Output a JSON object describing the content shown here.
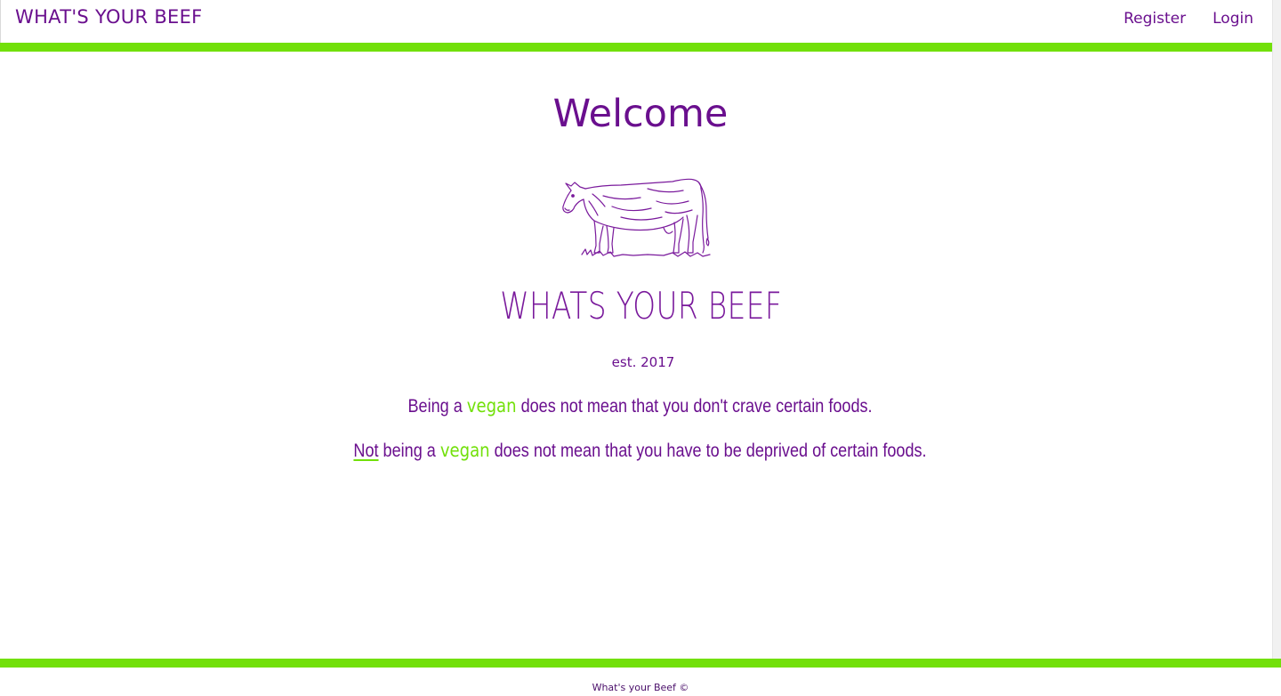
{
  "navbar": {
    "brand": "WHAT'S YOUR BEEF",
    "links": [
      {
        "label": "Register"
      },
      {
        "label": "Login"
      }
    ]
  },
  "hero": {
    "welcome": "Welcome",
    "cow_image": "cow-illustration",
    "logo_title": "WHATS YOUR BEEF",
    "established": "est. 2017"
  },
  "taglines": {
    "line1": {
      "before": "Being a ",
      "highlight": "vegan",
      "after": " does not mean that you don't crave certain foods."
    },
    "line2": {
      "underlined": "Not",
      "before": " being a ",
      "highlight": "vegan",
      "after": " does not mean that you have to be deprived of certain foods."
    }
  },
  "footer": {
    "text": "What's your Beef ©"
  },
  "colors": {
    "primary_purple": "#6a0f8e",
    "accent_green": "#72e00a",
    "background": "#ffffff"
  }
}
